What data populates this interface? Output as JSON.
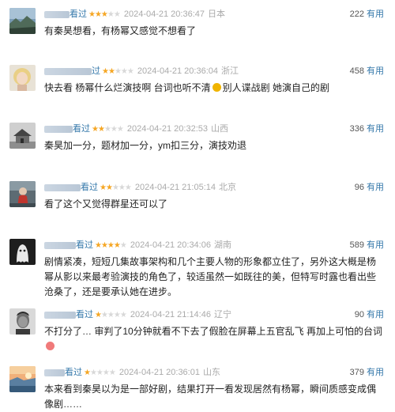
{
  "reviews": [
    {
      "name_suffix": "看过",
      "rating": 3,
      "time": "2024-04-21 20:36:47",
      "location": "日本",
      "votes": "222",
      "useful_label": "有用",
      "content": "有秦昊想看，有杨幂又感觉不想看了",
      "avatar": "landscape-avatar"
    },
    {
      "name_suffix": "过",
      "rating": 2,
      "time": "2024-04-21 20:36:04",
      "location": "浙江",
      "votes": "458",
      "useful_label": "有用",
      "content_before": "快去看 杨幂什么烂演技啊 台词也听不清",
      "content_after": "别人谍战剧 她演自己的剧",
      "avatar": "blonde-woman-avatar"
    },
    {
      "name_suffix": "看过",
      "rating": 2,
      "time": "2024-04-21 20:32:53",
      "location": "山西",
      "votes": "336",
      "useful_label": "有用",
      "content": "秦昊加一分，题材加一分，ym扣三分，演技劝退",
      "avatar": "house-avatar"
    },
    {
      "name_suffix": "看过",
      "rating": 2,
      "time": "2024-04-21 21:05:14",
      "location": "北京",
      "votes": "96",
      "useful_label": "有用",
      "content": "看了这个又觉得群星还可以了",
      "avatar": "red-figure-avatar"
    },
    {
      "name_suffix": "看过",
      "rating": 4,
      "time": "2024-04-21 20:34:06",
      "location": "湖南",
      "votes": "589",
      "useful_label": "有用",
      "content": "剧情紧凑，短短几集故事架构和几个主要人物的形象都立住了，另外这大概是杨幂从影以来最考验演技的角色了，较适虽然一如既往的美，但特写时露也看出些沧桑了，还是要承认她在进步。",
      "avatar": "ghost-avatar"
    },
    {
      "name_suffix": "看过",
      "rating": 1,
      "time": "2024-04-21 21:14:46",
      "location": "辽宁",
      "votes": "90",
      "useful_label": "有用",
      "content_before": "不打分了… 审判了10分钟就看不下去了假脸在屏幕上五官乱飞 再加上可怕的台词",
      "content_after": "",
      "avatar": "man-portrait-avatar"
    },
    {
      "name_suffix": "看过",
      "rating": 1,
      "time": "2024-04-21 20:36:01",
      "location": "山东",
      "votes": "379",
      "useful_label": "有用",
      "content": "本来看到秦昊以为是一部好剧，结果打开一看发现居然有杨幂，瞬间质感变成偶像剧……",
      "avatar": "sunset-avatar"
    }
  ],
  "colors": {
    "star_on": "#f5a623",
    "star_off": "#d8d8d8",
    "link_blue": "#3377aa",
    "meta_gray": "#aaaaaa"
  }
}
